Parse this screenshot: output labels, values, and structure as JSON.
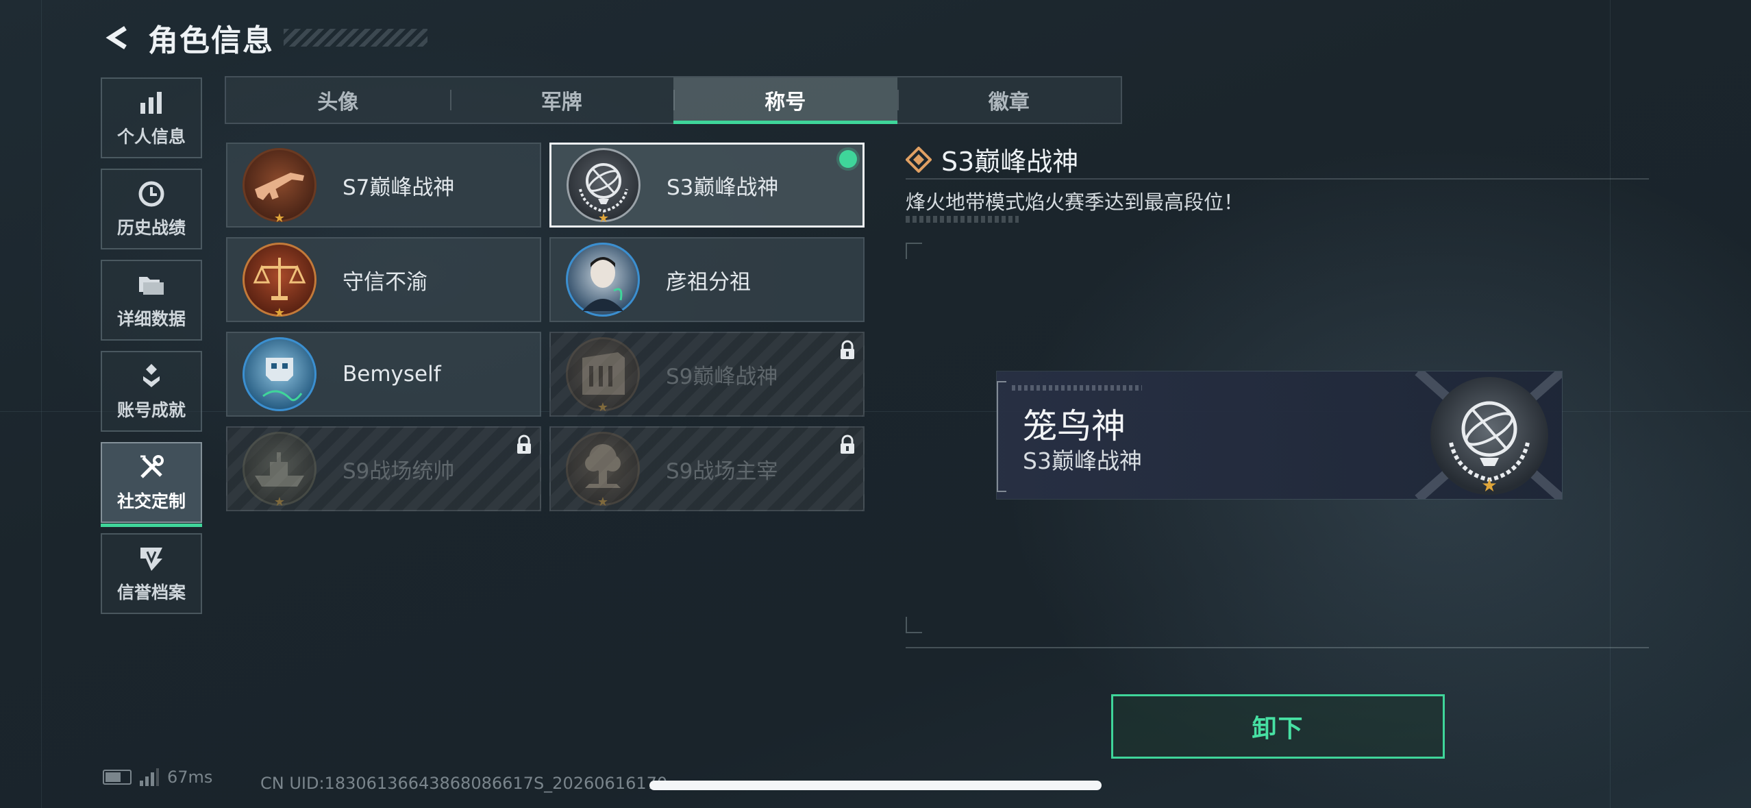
{
  "header": {
    "title": "角色信息"
  },
  "sidebar": {
    "items": [
      {
        "label": "个人信息",
        "icon": "bar-chart-icon"
      },
      {
        "label": "历史战绩",
        "icon": "clock-icon"
      },
      {
        "label": "详细数据",
        "icon": "folder-icon"
      },
      {
        "label": "账号成就",
        "icon": "achievement-icon"
      },
      {
        "label": "社交定制",
        "icon": "tools-icon",
        "active": true
      },
      {
        "label": "信誉档案",
        "icon": "credit-badge-icon"
      }
    ]
  },
  "tabs": [
    {
      "label": "头像"
    },
    {
      "label": "军牌"
    },
    {
      "label": "称号",
      "active": true
    },
    {
      "label": "徽章"
    }
  ],
  "titles": [
    {
      "name": "S7巅峰战神",
      "emblem": "rifle-emblem-icon",
      "locked": false,
      "selected": false
    },
    {
      "name": "S3巅峰战神",
      "emblem": "armillary-emblem-icon",
      "locked": false,
      "selected": true,
      "equipped": true
    },
    {
      "name": "守信不渝",
      "emblem": "scales-emblem-icon",
      "locked": false,
      "selected": false
    },
    {
      "name": "彦祖分祖",
      "emblem": "portrait-emblem-icon",
      "locked": false,
      "selected": false
    },
    {
      "name": "Bemyself",
      "emblem": "skull-emblem-icon",
      "locked": false,
      "selected": false
    },
    {
      "name": "S9巅峰战神",
      "emblem": "building-emblem-icon",
      "locked": true,
      "selected": false
    },
    {
      "name": "S9战场统帅",
      "emblem": "ship-emblem-icon",
      "locked": true,
      "selected": false
    },
    {
      "name": "S9战场主宰",
      "emblem": "explosion-emblem-icon",
      "locked": true,
      "selected": false
    }
  ],
  "detail": {
    "title": "S3巅峰战神",
    "description": "烽火地带模式焰火赛季达到最高段位！"
  },
  "preview": {
    "player_name": "笼鸟神",
    "title": "S3巅峰战神"
  },
  "unequip_label": "卸下",
  "status": {
    "ping": "67ms",
    "uid": "CN UID:18306136643868086617S_20260616170"
  },
  "colors": {
    "accent": "#3fd59a",
    "star": "#e0a63a",
    "detail_icon": "#e0a063"
  }
}
